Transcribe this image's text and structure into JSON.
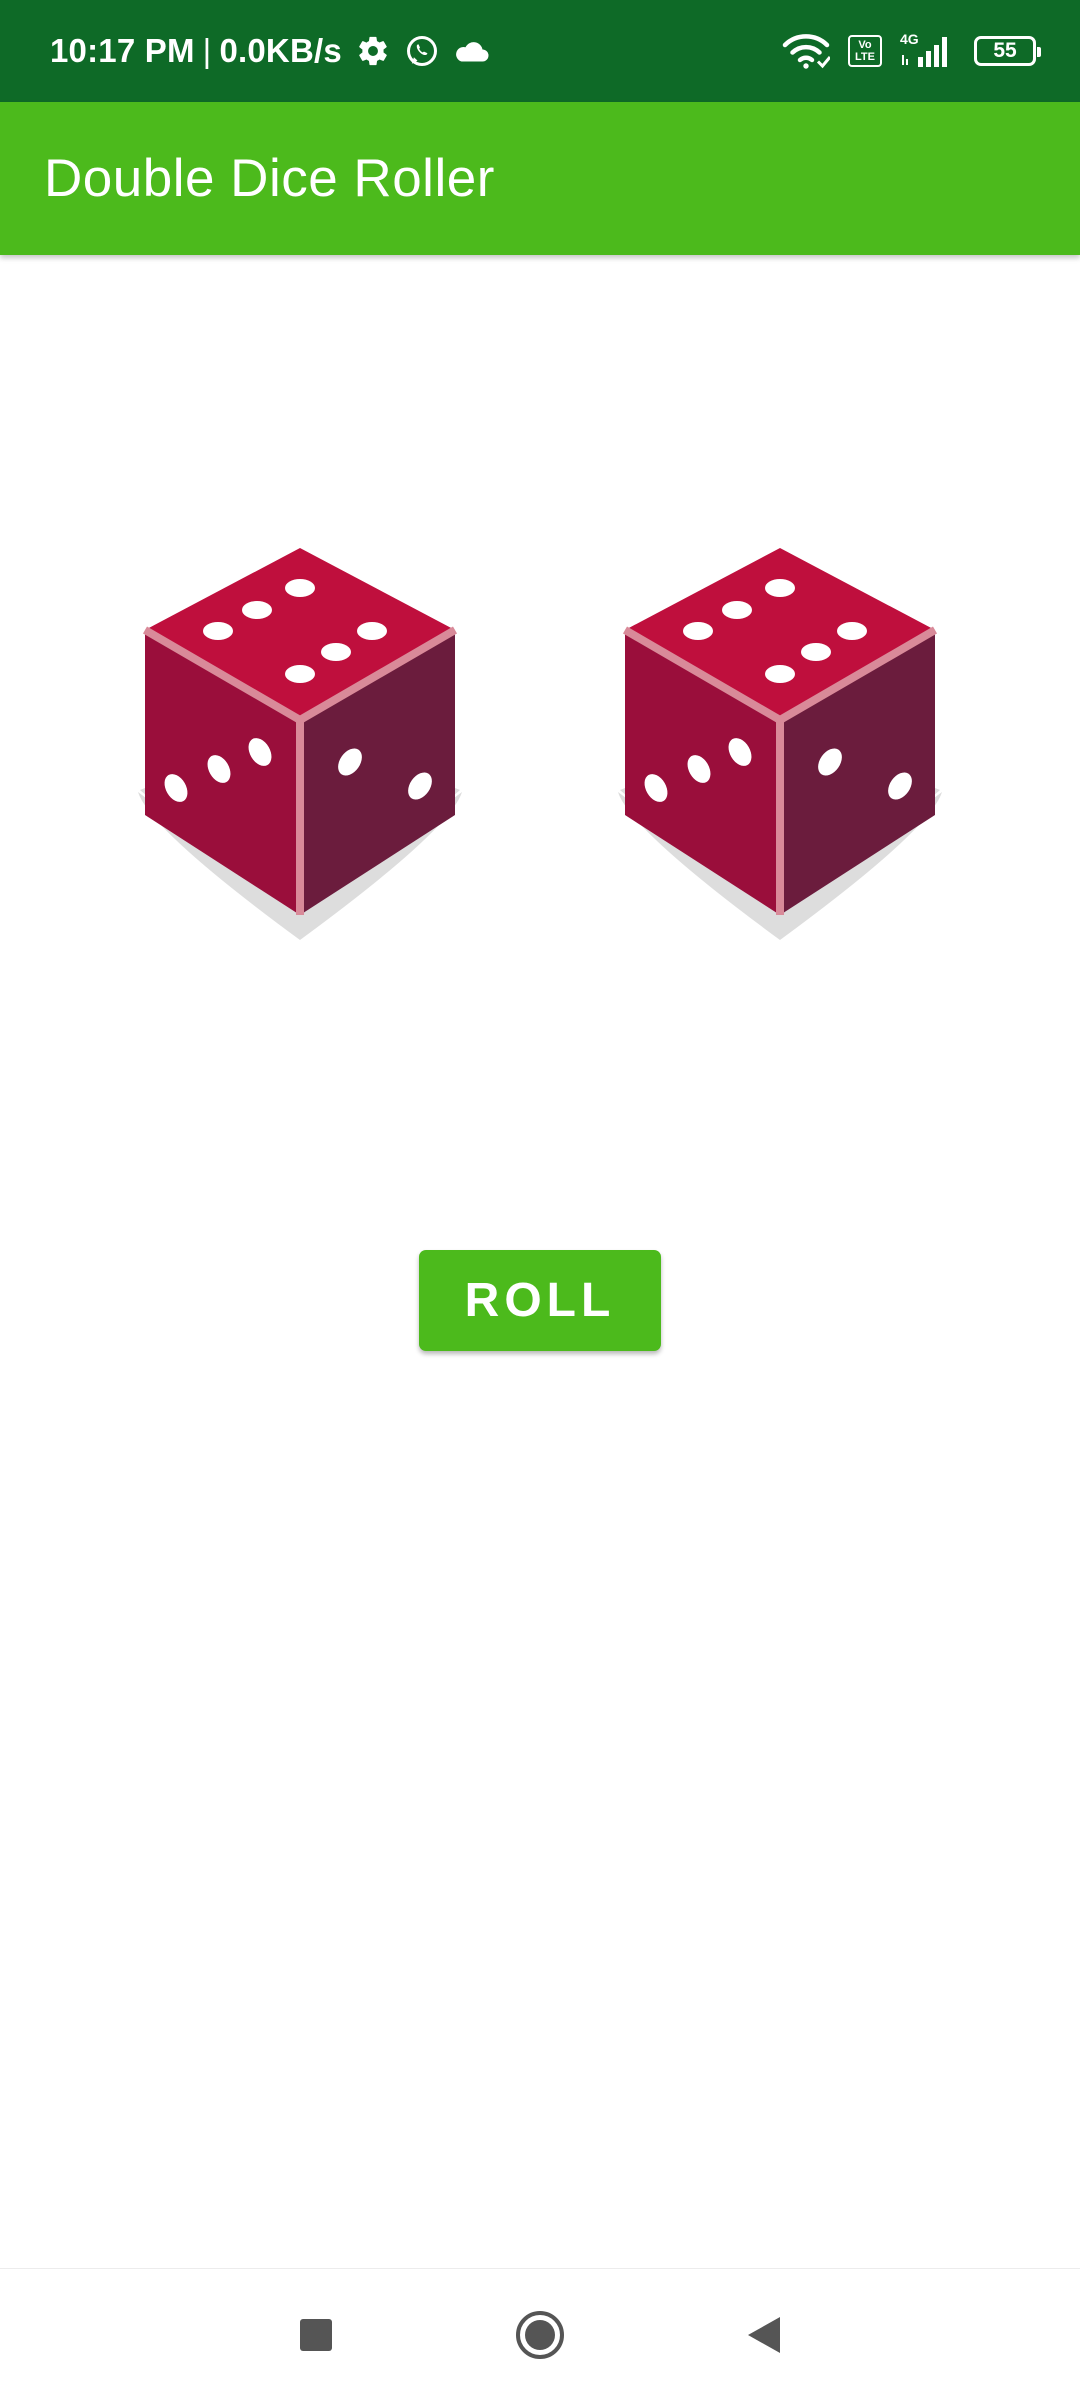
{
  "status_bar": {
    "time": "10:17 PM",
    "separator": "|",
    "network_speed": "0.0KB/s",
    "left_icons": [
      "settings-gear-icon",
      "whatsapp-icon",
      "cloud-icon"
    ],
    "right_icons": [
      "wifi-icon",
      "volte-icon",
      "signal-4g-icon",
      "battery-icon"
    ],
    "volte_label_top": "Vo",
    "volte_label_bottom": "LTE",
    "network_type": "4G",
    "battery_level": "55",
    "background_color": "#0e6a27"
  },
  "app_bar": {
    "title": "Double Dice Roller",
    "background_color": "#4cba1c"
  },
  "dice": [
    {
      "name": "die-left",
      "top_face": 6,
      "front_face": 3,
      "side_face": 2
    },
    {
      "name": "die-right",
      "top_face": 6,
      "front_face": 3,
      "side_face": 2
    }
  ],
  "dice_colors": {
    "top": "#bf0f3d",
    "front": "#9a0e3b",
    "side": "#6b1c3d",
    "edge": "#d98a99",
    "shadow": "#dddddd",
    "pip": "#ffffff"
  },
  "roll_button": {
    "label": "ROLL",
    "background_color": "#4cba1c"
  },
  "nav_bar": {
    "buttons": [
      "recents-square-icon",
      "home-circle-icon",
      "back-triangle-icon"
    ]
  }
}
